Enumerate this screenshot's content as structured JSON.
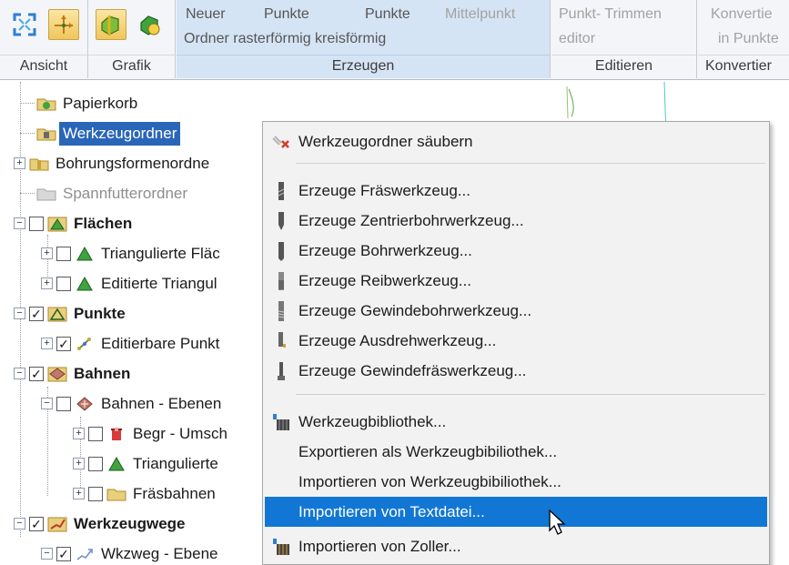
{
  "ribbon": {
    "groups": [
      {
        "label": "Ansicht"
      },
      {
        "label": "Grafik"
      },
      {
        "label": "Erzeugen",
        "buttons": [
          "Neuer Ordner",
          "Punkte rasterförmig",
          "Punkte kreisförmig",
          "Mittelpunkt"
        ]
      },
      {
        "label": "Editieren",
        "buttons": [
          "Punkt- editor",
          "Trimmen"
        ]
      },
      {
        "label": "Konvertier",
        "buttons": [
          "Konvertie in Punkte"
        ]
      }
    ],
    "erzeugen_line1": [
      "Neuer",
      "Punkte",
      "Punkte",
      "Mittelpunkt"
    ],
    "erzeugen_line2": "Ordner rasterförmig kreisförmig",
    "editieren_line1": "Punkt-  Trimmen",
    "editieren_line2": "editor",
    "konv_line1": "Konvertie",
    "konv_line2": "in Punkte"
  },
  "tree": [
    {
      "label": "Papierkorb"
    },
    {
      "label": "Werkzeugordner",
      "selected": true
    },
    {
      "label": "Bohrungsformenordne"
    },
    {
      "label": "Spannfutterordner",
      "disabled": true
    },
    {
      "label": "Flächen",
      "bold": true
    },
    {
      "label": "Triangulierte Fläc"
    },
    {
      "label": "Editierte Triangul"
    },
    {
      "label": "Punkte",
      "bold": true
    },
    {
      "label": "Editierbare Punkt"
    },
    {
      "label": "Bahnen",
      "bold": true
    },
    {
      "label": "Bahnen - Ebenen"
    },
    {
      "label": "Begr - Umsch"
    },
    {
      "label": "Triangulierte"
    },
    {
      "label": "Fräsbahnen"
    },
    {
      "label": "Werkzeugwege",
      "bold": true
    },
    {
      "label": "Wkzweg - Ebene"
    }
  ],
  "menu": {
    "items": [
      {
        "label": "Werkzeugordner säubern",
        "icon": "broom-delete-icon"
      },
      {
        "label": "Erzeuge Fräswerkzeug...",
        "icon": "end-mill-icon"
      },
      {
        "label": "Erzeuge Zentrierbohrwerkzeug...",
        "icon": "center-drill-icon"
      },
      {
        "label": "Erzeuge Bohrwerkzeug...",
        "icon": "drill-icon"
      },
      {
        "label": "Erzeuge Reibwerkzeug...",
        "icon": "reamer-icon"
      },
      {
        "label": "Erzeuge Gewindebohrwerkzeug...",
        "icon": "tap-icon"
      },
      {
        "label": "Erzeuge Ausdrehwerkzeug...",
        "icon": "boring-bar-icon"
      },
      {
        "label": "Erzeuge Gewindefräswerkzeug...",
        "icon": "thread-mill-icon"
      },
      {
        "label": "Werkzeugbibliothek...",
        "icon": "tool-library-icon"
      },
      {
        "label": "Exportieren als Werkzeugbibiliothek..."
      },
      {
        "label": "Importieren von Werkzeugbibiliothek..."
      },
      {
        "label": "Importieren von Textdatei...",
        "highlighted": true
      },
      {
        "label": "Importieren von Zoller...",
        "icon": "zoller-icon"
      }
    ]
  },
  "colors": {
    "selection": "#2a66b8",
    "menu_highlight": "#1277d4",
    "ribbon_bg": "#f3f5f8"
  }
}
